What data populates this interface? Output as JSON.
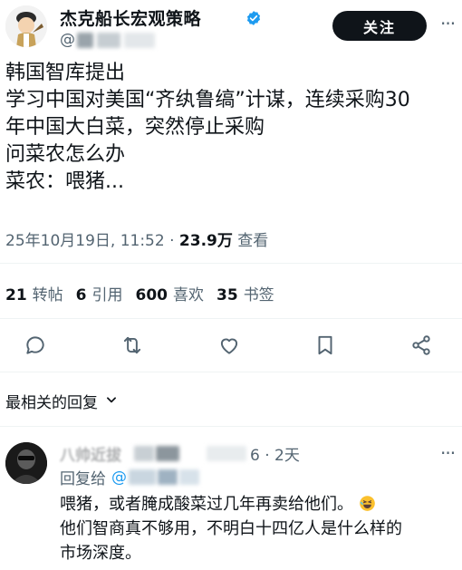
{
  "post": {
    "author_name": "杰克船长宏观策略",
    "handle_prefix": "@",
    "follow_label": "关注",
    "more_icon": "more-horizontal-icon",
    "body_lines": [
      "韩国智库提出",
      "学习中国对美国“齐纨鲁缟”计谋，连续采购30",
      "年中国大白菜，突然停止采购",
      "问菜农怎么办",
      "菜农：喂猪..."
    ],
    "timestamp": "25年10月19日, 11:52 · ",
    "views_count": "23.9万",
    "views_label": "查看"
  },
  "stats": {
    "reposts_count": "21",
    "reposts_label": "转帖",
    "quotes_count": "6",
    "quotes_label": "引用",
    "likes_count": "600",
    "likes_label": "喜欢",
    "bookmarks_count": "35",
    "bookmarks_label": "书签"
  },
  "actions": {
    "icons": [
      "reply-icon",
      "repost-icon",
      "like-icon",
      "bookmark-icon",
      "share-icon"
    ]
  },
  "replies_section": {
    "sort_label": "最相关的回复"
  },
  "reply": {
    "name_partial": "八帅近拔",
    "time_suffix": "6 · 2天",
    "reply_to_label": "回复给",
    "reply_to_handle": "@",
    "body_lines": [
      "喂猪，或者腌成酸菜过几年再卖给他们。",
      "他们智商真不够用，不明白十四亿人是什么样的",
      "市场深度。"
    ]
  },
  "colors": {
    "text_primary": "#0f1419",
    "text_secondary": "#536471",
    "accent_blue": "#1d9bf0",
    "follow_bg": "#0f1419"
  }
}
